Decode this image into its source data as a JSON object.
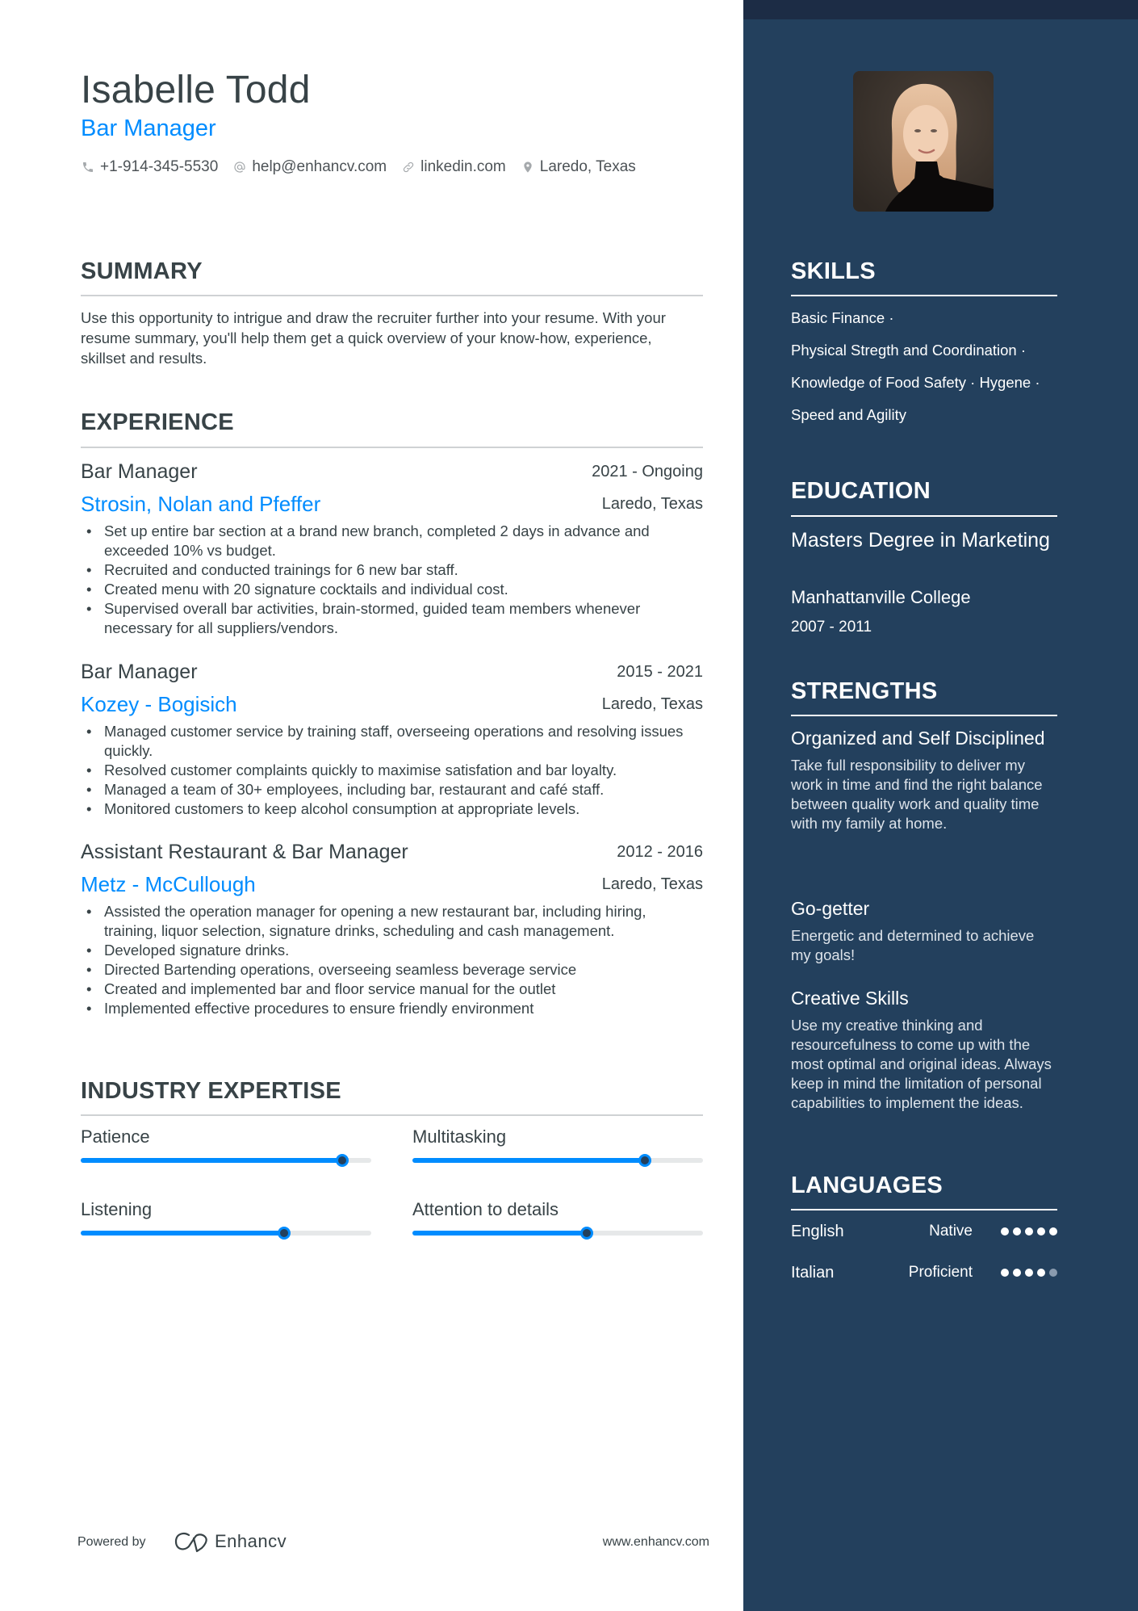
{
  "header": {
    "name": "Isabelle Todd",
    "role": "Bar Manager",
    "contacts": [
      {
        "icon": "phone-icon",
        "text": "+1-914-345-5530"
      },
      {
        "icon": "at-icon",
        "text": "help@enhancv.com"
      },
      {
        "icon": "link-icon",
        "text": "linkedin.com"
      },
      {
        "icon": "location-pin-icon",
        "text": "Laredo, Texas"
      }
    ]
  },
  "summary": {
    "title": "SUMMARY",
    "text": "Use this opportunity to intrigue and draw the recruiter further into your resume. With your resume summary, you'll help them get a quick overview of your know-how, experience, skillset and results."
  },
  "experience": {
    "title": "EXPERIENCE",
    "jobs": [
      {
        "title": "Bar Manager",
        "dates": "2021 - Ongoing",
        "company": "Strosin, Nolan and Pfeffer",
        "location": "Laredo, Texas",
        "bullets": [
          "Set up entire bar section at a brand new branch, completed 2 days in advance and exceeded 10% vs budget.",
          "Recruited and conducted trainings for 6 new bar staff.",
          "Created menu with 20 signature cocktails and individual cost.",
          "Supervised overall bar activities, brain-stormed, guided team members whenever necessary for all suppliers/vendors."
        ]
      },
      {
        "title": "Bar Manager",
        "dates": "2015 - 2021",
        "company": "Kozey - Bogisich",
        "location": "Laredo, Texas",
        "bullets": [
          "Managed customer service by training staff, overseeing operations and resolving issues quickly.",
          "Resolved customer complaints quickly to maximise satisfation and bar loyalty.",
          "Managed a team of 30+ employees, including bar, restaurant and café staff.",
          "Monitored customers to keep alcohol consumption at appropriate levels."
        ]
      },
      {
        "title": "Assistant Restaurant & Bar Manager",
        "dates": "2012 - 2016",
        "company": "Metz - McCullough",
        "location": "Laredo, Texas",
        "bullets": [
          "Assisted the operation manager for opening a new restaurant bar, including hiring, training, liquor selection, signature drinks, scheduling and cash management.",
          "Developed signature drinks.",
          "Directed Bartending operations, overseeing seamless beverage service",
          "Created and implemented bar and floor service manual for the outlet",
          "Implemented effective procedures to ensure friendly environment"
        ]
      }
    ]
  },
  "expertise": {
    "title": "INDUSTRY EXPERTISE",
    "items": [
      {
        "label": "Patience",
        "level": 0.9
      },
      {
        "label": "Multitasking",
        "level": 0.8
      },
      {
        "label": "Listening",
        "level": 0.7
      },
      {
        "label": "Attention to details",
        "level": 0.6
      }
    ]
  },
  "footer": {
    "powered_by": "Powered by",
    "brand": "Enhancv",
    "website": "www.enhancv.com"
  },
  "sidebar": {
    "photo_alt": "Profile photo",
    "skills": {
      "title": "SKILLS",
      "lines": [
        "Basic Finance ·",
        "Physical Stregth and Coordination ·",
        "Knowledge of Food Safety · Hygene ·",
        "Speed and Agility"
      ]
    },
    "education": {
      "title": "EDUCATION",
      "degree": "Masters Degree in Marketing",
      "school": "Manhattanville College",
      "dates": "2007 - 2011"
    },
    "strengths": {
      "title": "STRENGTHS",
      "items": [
        {
          "title": "Organized and Self Disciplined",
          "desc": "Take full responsibility to deliver my work in time and find the right balance between quality work and quality time with my family at home."
        },
        {
          "title": "Go-getter",
          "desc": "Energetic and determined to achieve my goals!"
        },
        {
          "title": "Creative Skills",
          "desc": "Use my creative thinking and resourcefulness to come up with the most optimal and original ideas. Always keep in mind the limitation of personal capabilities to implement the ideas."
        }
      ]
    },
    "languages": {
      "title": "LANGUAGES",
      "items": [
        {
          "name": "English",
          "level": "Native",
          "rating": 5,
          "max": 5
        },
        {
          "name": "Italian",
          "level": "Proficient",
          "rating": 4,
          "max": 5
        }
      ]
    }
  },
  "colors": {
    "accent": "#008cff",
    "sidebar": "#23405d",
    "sidebar_top": "#1c2c45",
    "text": "#384347"
  }
}
